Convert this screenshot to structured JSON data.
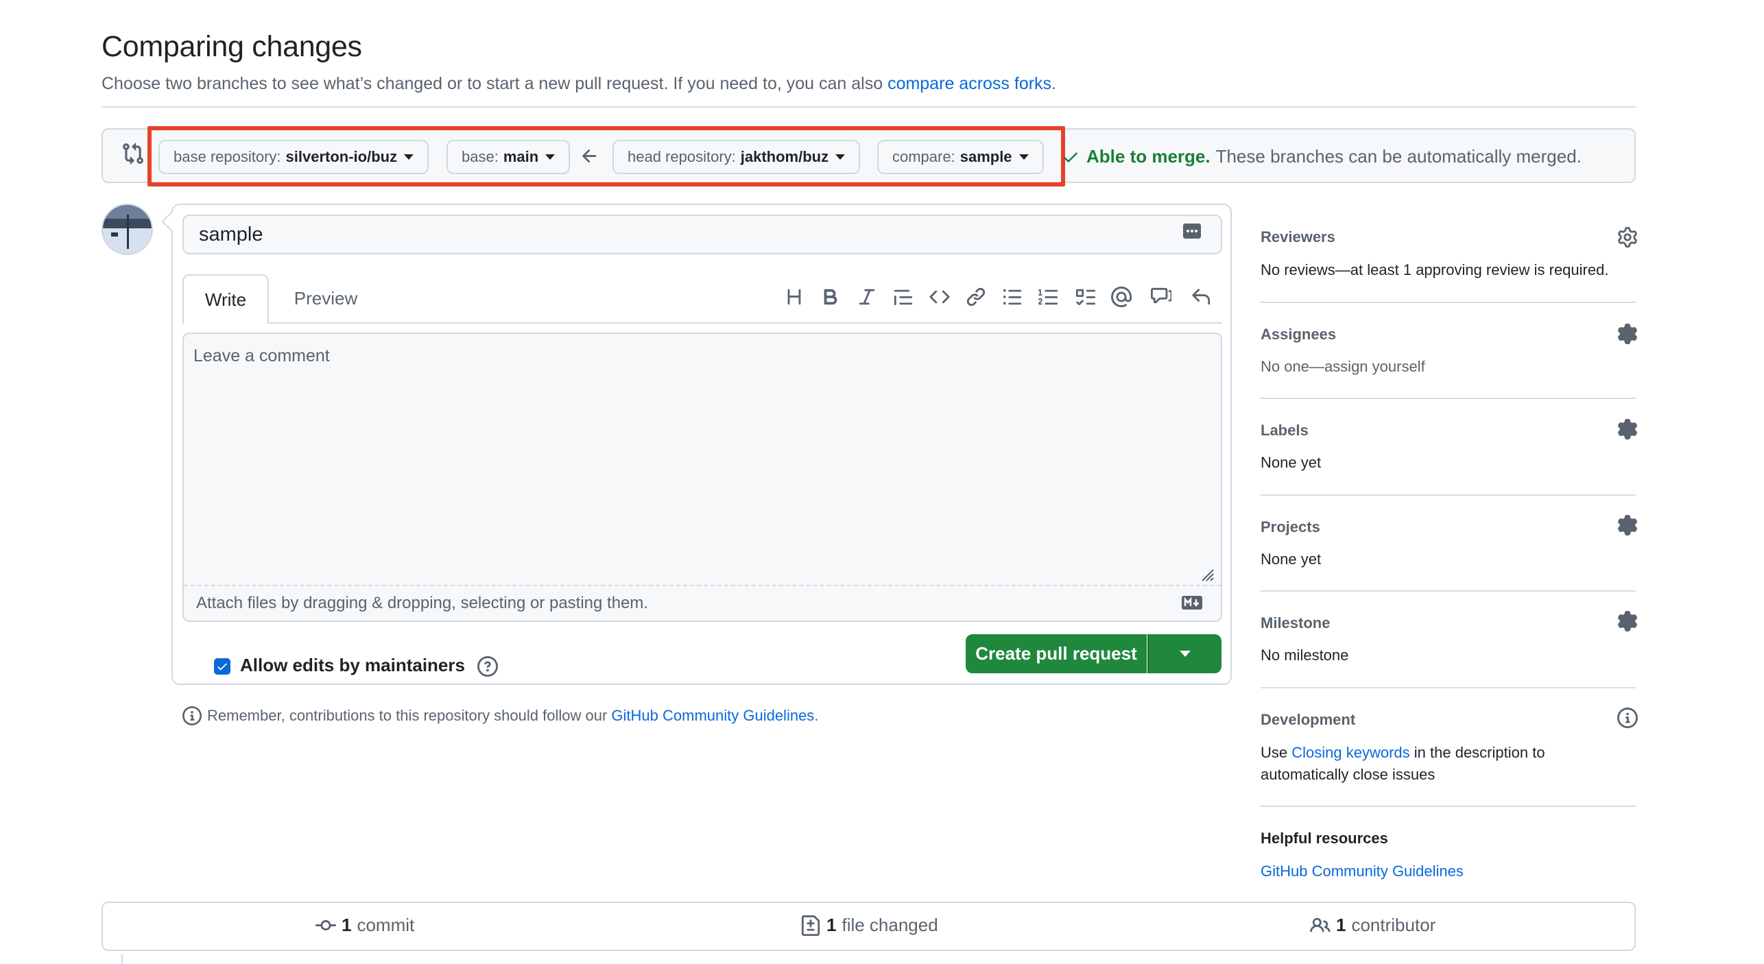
{
  "header": {
    "title": "Comparing changes",
    "subtitle": "Choose two branches to see what’s changed or to start a new pull request. If you need to, you can also",
    "subtitle_link": "compare across forks",
    "subtitle_end": "."
  },
  "range": {
    "base_repo_label": "base repository:",
    "base_repo_value": "silverton-io/buz",
    "base_label": "base:",
    "base_value": "main",
    "head_repo_label": "head repository:",
    "head_repo_value": "jakthom/buz",
    "compare_label": "compare:",
    "compare_value": "sample",
    "merge_status": "Able to merge.",
    "merge_text": "These branches can be automatically merged."
  },
  "form": {
    "title_value": "sample",
    "tab_write": "Write",
    "tab_preview": "Preview",
    "comment_placeholder": "Leave a comment",
    "attach_text": "Attach files by dragging & dropping, selecting or pasting them.",
    "allow_edits": "Allow edits by maintainers",
    "create_button": "Create pull request",
    "remember_text": "Remember, contributions to this repository should follow our",
    "remember_link": "GitHub Community Guidelines",
    "remember_end": "."
  },
  "sidebar": {
    "reviewers": {
      "heading": "Reviewers",
      "value": "No reviews—at least 1 approving review is required."
    },
    "assignees": {
      "heading": "Assignees",
      "value": "No one—assign yourself"
    },
    "labels": {
      "heading": "Labels",
      "value": "None yet"
    },
    "projects": {
      "heading": "Projects",
      "value": "None yet"
    },
    "milestone": {
      "heading": "Milestone",
      "value": "No milestone"
    },
    "development": {
      "heading": "Development",
      "value_prefix": "Use",
      "value_link": "Closing keywords",
      "value_suffix": "in the description to",
      "value_line2": "automatically close issues"
    },
    "helpful": {
      "heading": "Helpful resources",
      "link": "GitHub Community Guidelines"
    }
  },
  "summary": {
    "commits_count": "1",
    "commits_label": "commit",
    "files_count": "1",
    "files_label": "file changed",
    "contributors_count": "1",
    "contributors_label": "contributor"
  },
  "colors": {
    "accent": "#0969da",
    "success": "#1f883d",
    "highlight": "#e8412a"
  }
}
